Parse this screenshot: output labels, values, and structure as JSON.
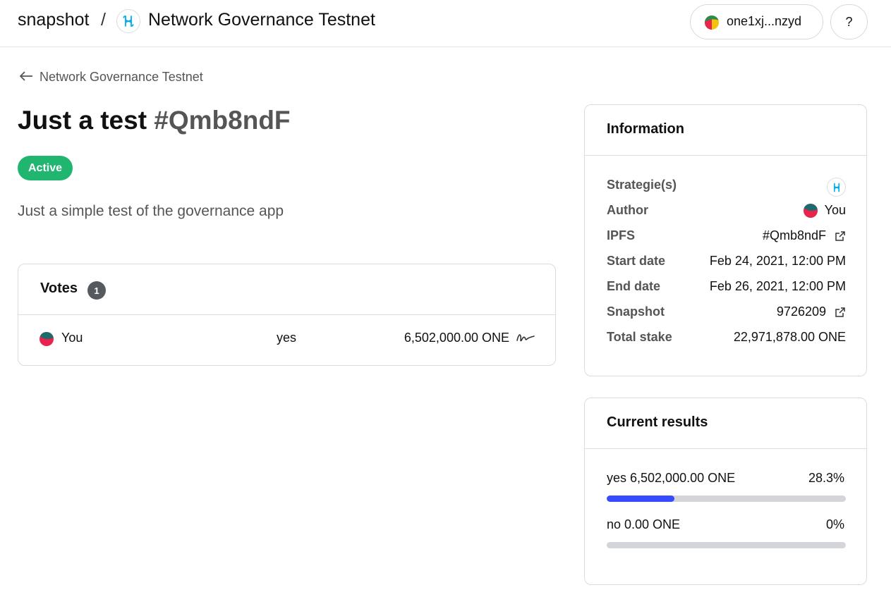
{
  "header": {
    "brand": "snapshot",
    "separator": "/",
    "space_name": "Network Governance Testnet",
    "account": "one1xj...nzyd",
    "help_label": "?"
  },
  "back_link": {
    "label": "Network Governance Testnet"
  },
  "proposal": {
    "title": "Just a test",
    "hash": "#Qmb8ndF",
    "state": "Active",
    "body": "Just a simple test of the governance app"
  },
  "votes": {
    "title": "Votes",
    "count": "1",
    "rows": [
      {
        "voter": "You",
        "choice": "yes",
        "power": "6,502,000.00 ONE"
      }
    ]
  },
  "info": {
    "title": "Information",
    "strategies_label": "Strategie(s)",
    "author_label": "Author",
    "author_value": "You",
    "ipfs_label": "IPFS",
    "ipfs_value": "#Qmb8ndF",
    "start_label": "Start date",
    "start_value": "Feb 24, 2021, 12:00 PM",
    "end_label": "End date",
    "end_value": "Feb 26, 2021, 12:00 PM",
    "snapshot_label": "Snapshot",
    "snapshot_value": "9726209",
    "stake_label": "Total stake",
    "stake_value": "22,971,878.00 ONE"
  },
  "results": {
    "title": "Current results",
    "items": [
      {
        "label": "yes 6,502,000.00 ONE",
        "percent_label": "28.3%",
        "fraction": 0.283
      },
      {
        "label": "no 0.00 ONE",
        "percent_label": "0%",
        "fraction": 0
      }
    ]
  },
  "colors": {
    "accent": "#384aff",
    "active_badge": "#21b66f",
    "bar_track": "#d3d5da",
    "harmony_teal": "#00aee9"
  },
  "icons": {
    "space_logo": "harmony-logo-icon",
    "back": "arrow-left-icon",
    "external": "external-link-icon",
    "signature": "signature-icon",
    "avatar": "avatar-icon"
  }
}
